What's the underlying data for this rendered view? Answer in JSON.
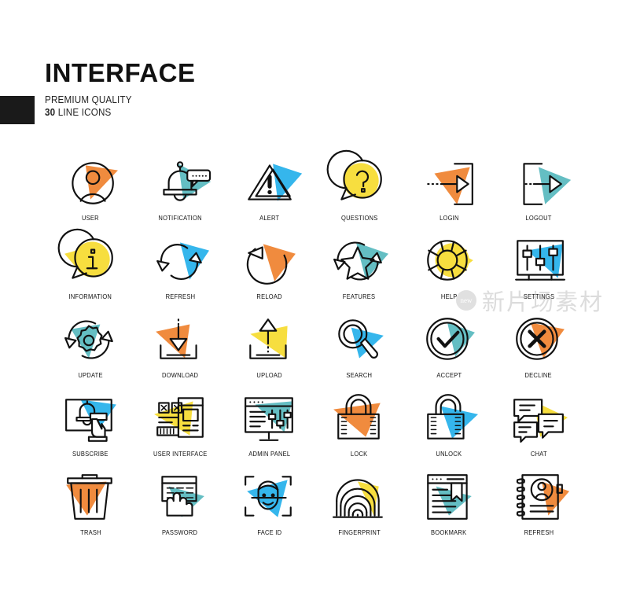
{
  "header": {
    "title": "INTERFACE",
    "subtitle_line1": "PREMIUM QUALITY",
    "count": "30",
    "subtitle_line2": "LINE ICONS"
  },
  "palette": {
    "orange": "#F08B3E",
    "teal": "#64BEC3",
    "blue": "#35B6EC",
    "yellow": "#F7DE3F",
    "ink": "#111111",
    "background": "#FFFFFF"
  },
  "watermark": {
    "badge": "new",
    "text": "新片场素材"
  },
  "grid": {
    "columns": 6,
    "rows": 5,
    "total": 30
  },
  "icons": [
    {
      "label": "USER",
      "icon": "user-icon",
      "accent": "orange"
    },
    {
      "label": "NOTIFICATION",
      "icon": "bell-icon",
      "accent": "teal"
    },
    {
      "label": "ALERT",
      "icon": "warning-triangle-icon",
      "accent": "blue"
    },
    {
      "label": "QUESTIONS",
      "icon": "question-bubble-icon",
      "accent": "yellow"
    },
    {
      "label": "LOGIN",
      "icon": "login-arrow-icon",
      "accent": "orange"
    },
    {
      "label": "LOGOUT",
      "icon": "logout-arrow-icon",
      "accent": "teal"
    },
    {
      "label": "INFORMATION",
      "icon": "info-bubble-icon",
      "accent": "yellow"
    },
    {
      "label": "REFRESH",
      "icon": "refresh-arrows-icon",
      "accent": "blue"
    },
    {
      "label": "RELOAD",
      "icon": "reload-arrow-icon",
      "accent": "orange"
    },
    {
      "label": "FEATURES",
      "icon": "star-cycle-icon",
      "accent": "teal"
    },
    {
      "label": "HELP",
      "icon": "lifebuoy-icon",
      "accent": "yellow"
    },
    {
      "label": "SETTINGS",
      "icon": "monitor-sliders-icon",
      "accent": "blue"
    },
    {
      "label": "UPDATE",
      "icon": "gear-cycle-icon",
      "accent": "teal"
    },
    {
      "label": "DOWNLOAD",
      "icon": "download-arrow-icon",
      "accent": "orange"
    },
    {
      "label": "UPLOAD",
      "icon": "upload-arrow-icon",
      "accent": "yellow"
    },
    {
      "label": "SEARCH",
      "icon": "magnifier-icon",
      "accent": "blue"
    },
    {
      "label": "ACCEPT",
      "icon": "check-circle-icon",
      "accent": "teal"
    },
    {
      "label": "DECLINE",
      "icon": "cross-circle-icon",
      "accent": "orange"
    },
    {
      "label": "SUBSCRIBE",
      "icon": "subscribe-hand-icon",
      "accent": "blue"
    },
    {
      "label": "USER INTERFACE",
      "icon": "ui-layout-icon",
      "accent": "yellow"
    },
    {
      "label": "ADMIN PANEL",
      "icon": "admin-monitor-icon",
      "accent": "teal"
    },
    {
      "label": "LOCK",
      "icon": "padlock-closed-icon",
      "accent": "orange"
    },
    {
      "label": "UNLOCK",
      "icon": "padlock-open-icon",
      "accent": "blue"
    },
    {
      "label": "CHAT",
      "icon": "chat-bubbles-icon",
      "accent": "yellow"
    },
    {
      "label": "TRASH",
      "icon": "trash-bin-icon",
      "accent": "orange"
    },
    {
      "label": "PASSWORD",
      "icon": "keypad-hand-icon",
      "accent": "teal"
    },
    {
      "label": "FACE ID",
      "icon": "face-id-icon",
      "accent": "blue"
    },
    {
      "label": "FINGERPRINT",
      "icon": "fingerprint-icon",
      "accent": "yellow"
    },
    {
      "label": "BOOKMARK",
      "icon": "bookmark-page-icon",
      "accent": "teal"
    },
    {
      "label": "REFRESH",
      "icon": "contact-book-icon",
      "accent": "orange"
    }
  ]
}
